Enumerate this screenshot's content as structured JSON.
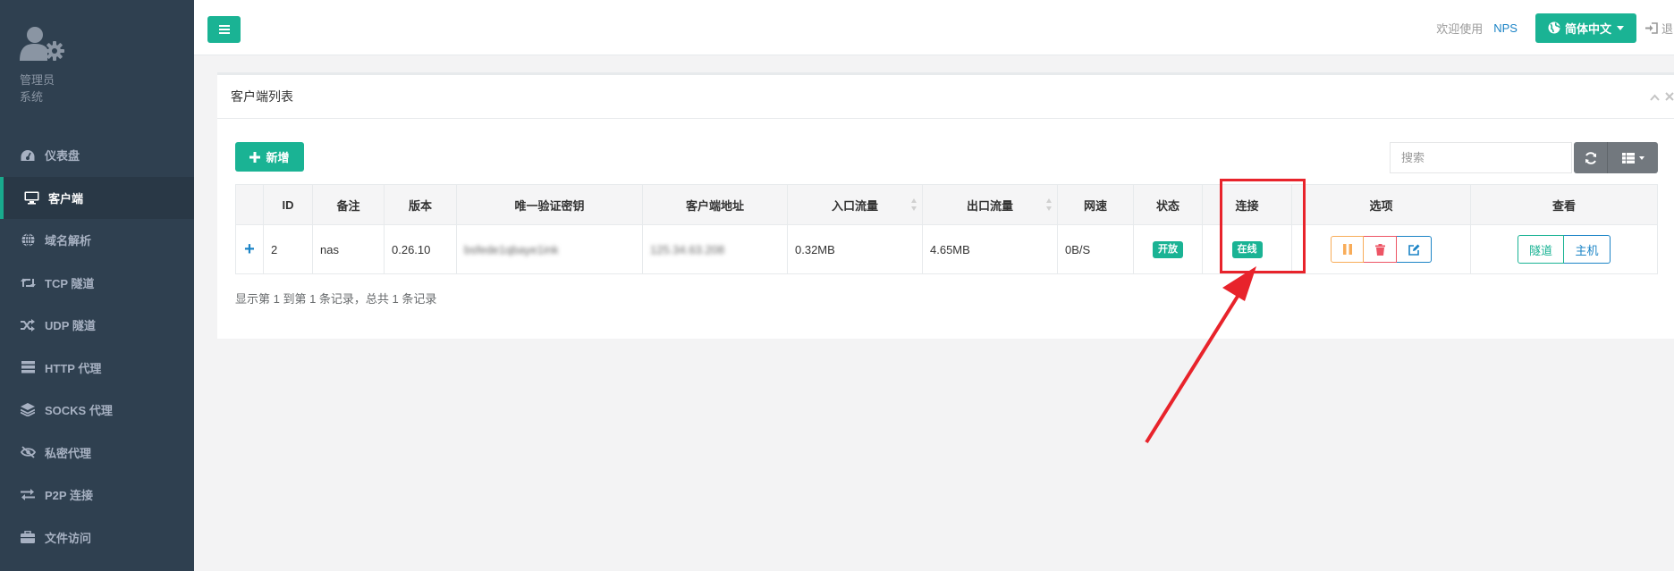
{
  "sidebar": {
    "role_line1": "管理员",
    "role_line2": "系统",
    "items": [
      {
        "label": "仪表盘",
        "icon": "dashboard-icon",
        "active": false
      },
      {
        "label": "客户端",
        "icon": "desktop-icon",
        "active": true
      },
      {
        "label": "域名解析",
        "icon": "globe-icon",
        "active": false
      },
      {
        "label": "TCP 隧道",
        "icon": "retweet-icon",
        "active": false
      },
      {
        "label": "UDP 隧道",
        "icon": "random-icon",
        "active": false
      },
      {
        "label": "HTTP 代理",
        "icon": "server-icon",
        "active": false
      },
      {
        "label": "SOCKS 代理",
        "icon": "layers-icon",
        "active": false
      },
      {
        "label": "私密代理",
        "icon": "eye-slash-icon",
        "active": false
      },
      {
        "label": "P2P 连接",
        "icon": "exchange-icon",
        "active": false
      },
      {
        "label": "文件访问",
        "icon": "briefcase-icon",
        "active": false
      }
    ]
  },
  "topbar": {
    "welcome": "欢迎使用",
    "brand": "NPS",
    "language": "简体中文",
    "logout": "退出"
  },
  "panel": {
    "title": "客户端列表",
    "add_label": "新增",
    "search_placeholder": "搜索",
    "columns": [
      "ID",
      "备注",
      "版本",
      "唯一验证密钥",
      "客户端地址",
      "入口流量",
      "出口流量",
      "网速",
      "状态",
      "连接",
      "选项",
      "查看"
    ],
    "rows": [
      {
        "expand": "+",
        "id": "2",
        "remark": "nas",
        "version": "0.26.10",
        "vkey": "bsfede1qbaye1ink",
        "address": "125.34.63.208",
        "in_flow": "0.32MB",
        "out_flow": "4.65MB",
        "speed": "0B/S",
        "status": "开放",
        "connection": "在线",
        "view_tunnel": "隧道",
        "view_host": "主机"
      }
    ],
    "records_text": "显示第 1 到第 1 条记录，总共 1 条记录"
  },
  "colors": {
    "sidebar_bg": "#2f4050",
    "primary": "#1ab394",
    "info": "#1c84c6",
    "warning": "#f8ac59",
    "danger": "#ed5565",
    "annotation_red": "#e8232b"
  }
}
